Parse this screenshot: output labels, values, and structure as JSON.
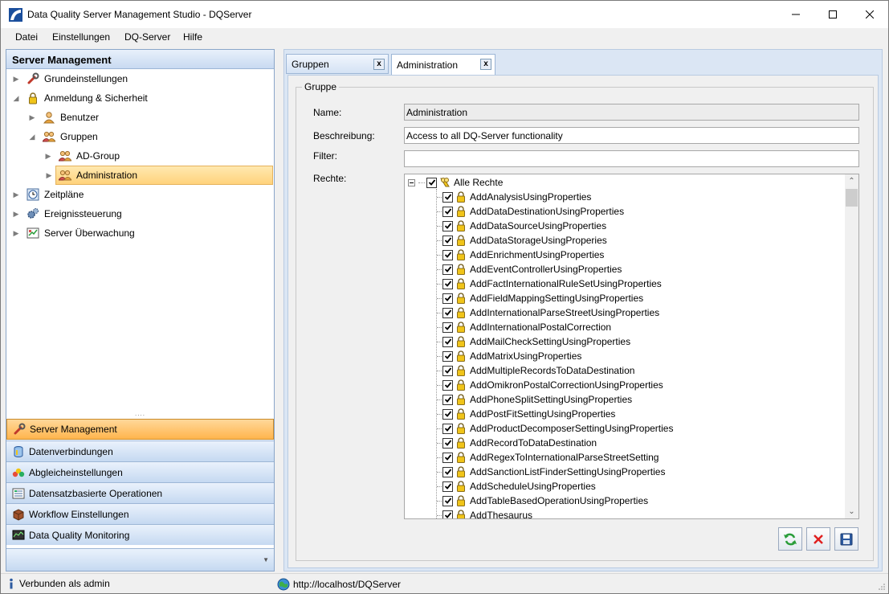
{
  "window": {
    "title": "Data Quality Server Management Studio - DQServer"
  },
  "menu": [
    "Datei",
    "Einstellungen",
    "DQ-Server",
    "Hilfe"
  ],
  "left_panel": {
    "header": "Server Management",
    "tree": [
      {
        "label": "Grundeinstellungen",
        "level": 0,
        "expanded": false,
        "icon": "wrench-icon"
      },
      {
        "label": "Anmeldung & Sicherheit",
        "level": 0,
        "expanded": true,
        "icon": "lock-icon"
      },
      {
        "label": "Benutzer",
        "level": 1,
        "expanded": false,
        "icon": "user-icon"
      },
      {
        "label": "Gruppen",
        "level": 1,
        "expanded": true,
        "icon": "users-icon"
      },
      {
        "label": "AD-Group",
        "level": 2,
        "expanded": false,
        "icon": "users-icon"
      },
      {
        "label": "Administration",
        "level": 2,
        "expanded": false,
        "icon": "users-icon",
        "selected": true
      },
      {
        "label": "Zeitpläne",
        "level": 0,
        "expanded": false,
        "icon": "clock-icon"
      },
      {
        "label": "Ereignissteuerung",
        "level": 0,
        "expanded": false,
        "icon": "gears-icon"
      },
      {
        "label": "Server Überwachung",
        "level": 0,
        "expanded": false,
        "icon": "monitor-icon"
      }
    ],
    "nav_buttons": [
      {
        "label": "Server Management",
        "icon": "wrench-icon",
        "active": true
      },
      {
        "label": "Datenverbindungen",
        "icon": "database-icon"
      },
      {
        "label": "Abgleicheinstellungen",
        "icon": "balls-icon"
      },
      {
        "label": "Datensatzbasierte Operationen",
        "icon": "records-icon"
      },
      {
        "label": "Workflow Einstellungen",
        "icon": "box-icon"
      },
      {
        "label": "Data Quality Monitoring",
        "icon": "chart-icon"
      }
    ]
  },
  "tabs": [
    {
      "label": "Gruppen",
      "close": "x",
      "active": false
    },
    {
      "label": "Administration",
      "close": "x",
      "active": true
    }
  ],
  "form": {
    "group_title": "Gruppe",
    "name_label": "Name:",
    "name_value": "Administration",
    "desc_label": "Beschreibung:",
    "desc_value": "Access to all DQ-Server functionality",
    "filter_label": "Filter:",
    "filter_value": "",
    "rights_label": "Rechte:",
    "rights_root": "Alle Rechte",
    "rights": [
      "AddAnalysisUsingProperties",
      "AddDataDestinationUsingProperties",
      "AddDataSourceUsingProperties",
      "AddDataStorageUsingProperies",
      "AddEnrichmentUsingProperties",
      "AddEventControllerUsingProperties",
      "AddFactInternationalRuleSetUsingProperties",
      "AddFieldMappingSettingUsingProperties",
      "AddInternationalParseStreetUsingProperties",
      "AddInternationalPostalCorrection",
      "AddMailCheckSettingUsingProperties",
      "AddMatrixUsingProperties",
      "AddMultipleRecordsToDataDestination",
      "AddOmikronPostalCorrectionUsingProperties",
      "AddPhoneSplitSettingUsingProperties",
      "AddPostFitSettingUsingProperties",
      "AddProductDecomposerSettingUsingProperties",
      "AddRecordToDataDestination",
      "AddRegexToInternationalParseStreetSetting",
      "AddSanctionListFinderSettingUsingProperties",
      "AddScheduleUsingProperties",
      "AddTableBasedOperationUsingProperties",
      "AddThesaurus"
    ]
  },
  "status": {
    "left": "Verbunden als admin",
    "url": "http://localhost/DQServer"
  },
  "colors": {
    "accent": "#ffb54d",
    "header": "#c8daf1",
    "selected": "#ffd37c"
  }
}
